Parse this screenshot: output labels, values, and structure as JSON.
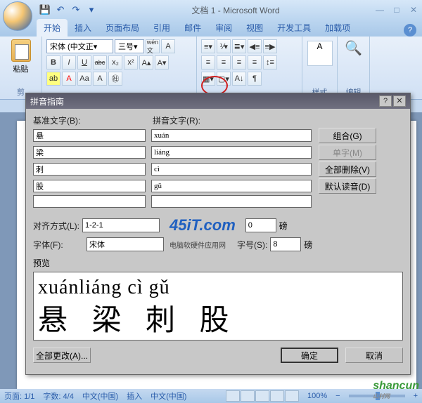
{
  "window": {
    "title": "文档 1 - Microsoft Word"
  },
  "tabs": {
    "home": "开始",
    "insert": "插入",
    "layout": "页面布局",
    "references": "引用",
    "mail": "邮件",
    "review": "审阅",
    "view": "视图",
    "developer": "开发工具",
    "addins": "加载项"
  },
  "ribbon": {
    "paste": "粘贴",
    "clipboard_label": "剪",
    "font_name": "宋体 (中文正",
    "font_size": "三号",
    "font_group_label": "",
    "bold": "B",
    "italic": "I",
    "underline": "U",
    "strike": "abc",
    "sub": "x₂",
    "sup": "x²",
    "styles_label": "样式",
    "editing_label": "编辑"
  },
  "dialog": {
    "title": "拼音指南",
    "base_label": "基准文字(B):",
    "ruby_label": "拼音文字(R):",
    "rows": [
      {
        "base": "悬",
        "ruby": "xuán"
      },
      {
        "base": "梁",
        "ruby": "liáng"
      },
      {
        "base": "刺",
        "ruby": "cì"
      },
      {
        "base": "股",
        "ruby": "gǔ"
      },
      {
        "base": "",
        "ruby": ""
      }
    ],
    "btn_combine": "组合(G)",
    "btn_single": "单字(M)",
    "btn_clear_all": "全部删除(V)",
    "btn_default": "默认读音(D)",
    "align_label": "对齐方式(L):",
    "align_value": "1-2-1",
    "offset_label": "",
    "offset_value": "0",
    "offset_unit": "磅",
    "font_label": "字体(F):",
    "font_value": "宋体",
    "size_label": "字号(S):",
    "size_value": "8",
    "size_unit": "磅",
    "preview_label": "预览",
    "preview_ruby": "xuánliáng cì gǔ",
    "preview_base": "悬 梁 刺 股",
    "btn_change_all": "全部更改(A)...",
    "btn_ok": "确定",
    "btn_cancel": "取消",
    "watermark": "45iT.com",
    "watermark_sub": "电脑软硬件应用网"
  },
  "statusbar": {
    "page": "页面: 1/1",
    "words": "字数: 4/4",
    "lang1": "中文(中国)",
    "mode": "插入",
    "lang2": "中文(中国)",
    "zoom": "100%",
    "zoom_minus": "−",
    "zoom_plus": "+"
  },
  "watermark_site": "shancun"
}
